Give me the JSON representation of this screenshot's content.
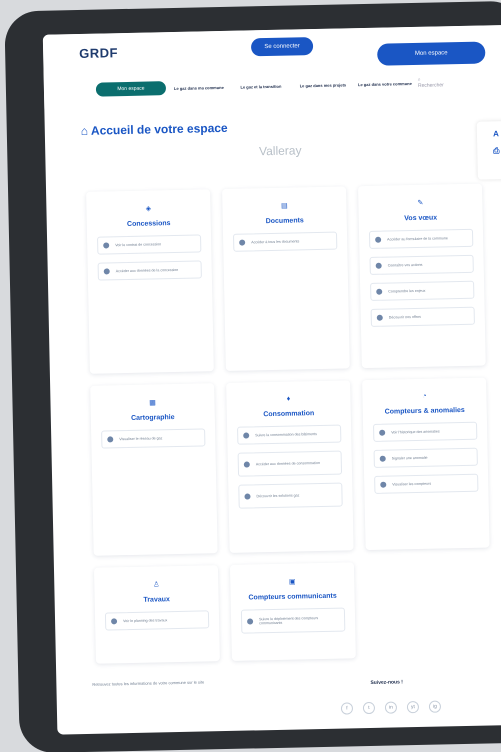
{
  "header": {
    "logo": "GRDF",
    "center_button": "Se connecter",
    "account_button": "Mon espace",
    "nav": [
      {
        "label": "Mon espace"
      },
      {
        "label": "Le gaz dans ma commune"
      },
      {
        "label": "Le gaz et la transition"
      },
      {
        "label": "Le gaz dans mes projets"
      },
      {
        "label": "Le gaz dans votre commune"
      }
    ],
    "search": "Rechercher"
  },
  "page": {
    "title": "Accueil de votre espace",
    "commune": "Valleray"
  },
  "cards": [
    {
      "title": "Concessions",
      "links": [
        "Voir le contrat de concession",
        "Accéder aux données de la concession"
      ]
    },
    {
      "title": "Documents",
      "links": [
        "Accéder à tous les documents"
      ]
    },
    {
      "title": "Vos vœux",
      "links": [
        "Accéder au formulaire de la commune",
        "Connaître vos actions",
        "Comprendre les enjeux",
        "Découvrir nos offres"
      ]
    },
    {
      "title": "Cartographie",
      "links": [
        "Visualiser le réseau de gaz"
      ]
    },
    {
      "title": "Consommation",
      "links": [
        "Suivre la consommation des bâtiments",
        "Accéder aux données de consommation",
        "Découvrir les solutions gaz"
      ]
    },
    {
      "title": "Compteurs & anomalies",
      "links": [
        "Voir l'historique des anomalies",
        "Signaler une anomalie",
        "Visualiser les compteurs"
      ]
    },
    {
      "title": "Travaux",
      "links": [
        "Voir le planning des travaux"
      ]
    },
    {
      "title": "Compteurs communicants",
      "links": [
        "Suivre le déploiement des compteurs communicants"
      ]
    }
  ],
  "footer": {
    "text": "Retrouvez toutes les informations de votre commune sur le site",
    "follow": "Suivez-nous !",
    "socials": [
      "f",
      "t",
      "in",
      "yt",
      "ig"
    ]
  },
  "tools": {
    "font_size": "A",
    "print": "⎙"
  },
  "colors": {
    "accent": "#1a56c4",
    "nav_active": "#0b6e6e",
    "title": "#1a56c4"
  }
}
